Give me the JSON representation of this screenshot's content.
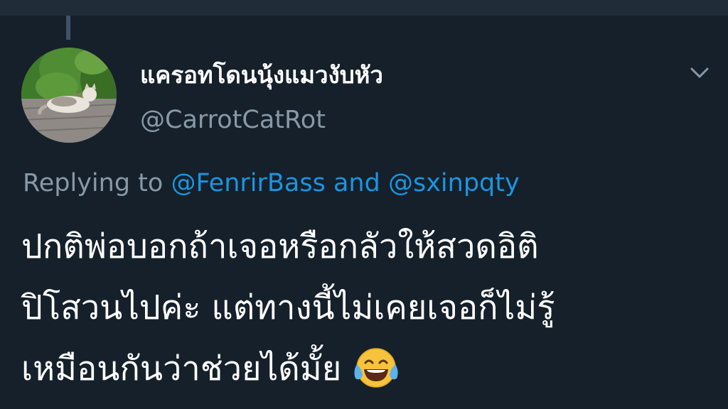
{
  "tweet": {
    "display_name": "แครอทโดนนุ้งแมวงับหัว",
    "handle": "@CarrotCatRot",
    "reply": {
      "prefix": "Replying to",
      "mention_1": "@FenrirBass",
      "and": "and",
      "mention_2": "@sxinpqty"
    },
    "text_lines": [
      "ปกติพ่อบอกถ้าเจอหรือกลัวให้สวดอิติ",
      "ปิโสวนไปค่ะ แต่ทางนี้ไม่เคยเจอก็ไม่รู้",
      "เหมือนกันว่าช่วยได้มั้ย"
    ],
    "emoji": "face-with-tears-of-joy",
    "menu_icon": "chevron-down-icon"
  },
  "colors": {
    "background": "#15202b",
    "primary_text": "#ffffff",
    "secondary_text": "#8899a6",
    "link": "#1b95e0"
  }
}
